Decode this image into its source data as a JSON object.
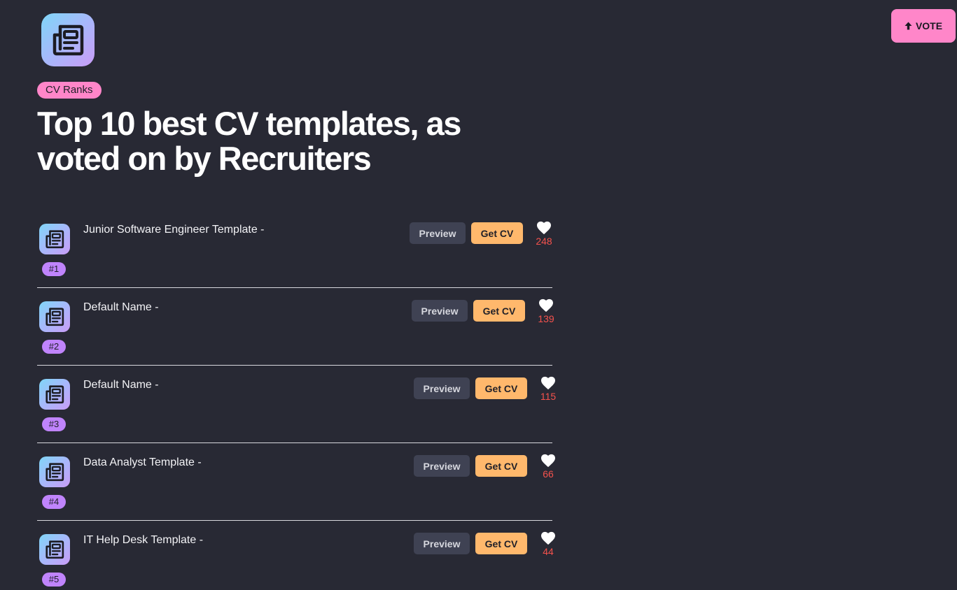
{
  "header": {
    "logo_icon": "newspaper-icon",
    "tag_label": "CV Ranks",
    "title": "Top 10 best CV templates, as voted on by Recruiters"
  },
  "vote_button": {
    "icon": "arrow-up-icon",
    "label": "VOTE"
  },
  "colors": {
    "background": "#282934",
    "accent_pink": "#ff86c9",
    "accent_orange": "#ffb86c",
    "rank_purple": "#c084fc",
    "like_red": "#f5524d"
  },
  "templates": [
    {
      "rank": "#1",
      "name": "Junior Software Engineer Template -",
      "preview_label": "Preview",
      "get_label": "Get CV",
      "likes": "248"
    },
    {
      "rank": "#2",
      "name": "Default Name -",
      "preview_label": "Preview",
      "get_label": "Get CV",
      "likes": "139"
    },
    {
      "rank": "#3",
      "name": "Default Name -",
      "preview_label": "Preview",
      "get_label": "Get CV",
      "likes": "115"
    },
    {
      "rank": "#4",
      "name": "Data Analyst Template -",
      "preview_label": "Preview",
      "get_label": "Get CV",
      "likes": "66"
    },
    {
      "rank": "#5",
      "name": "IT Help Desk Template -",
      "preview_label": "Preview",
      "get_label": "Get CV",
      "likes": "44"
    }
  ]
}
